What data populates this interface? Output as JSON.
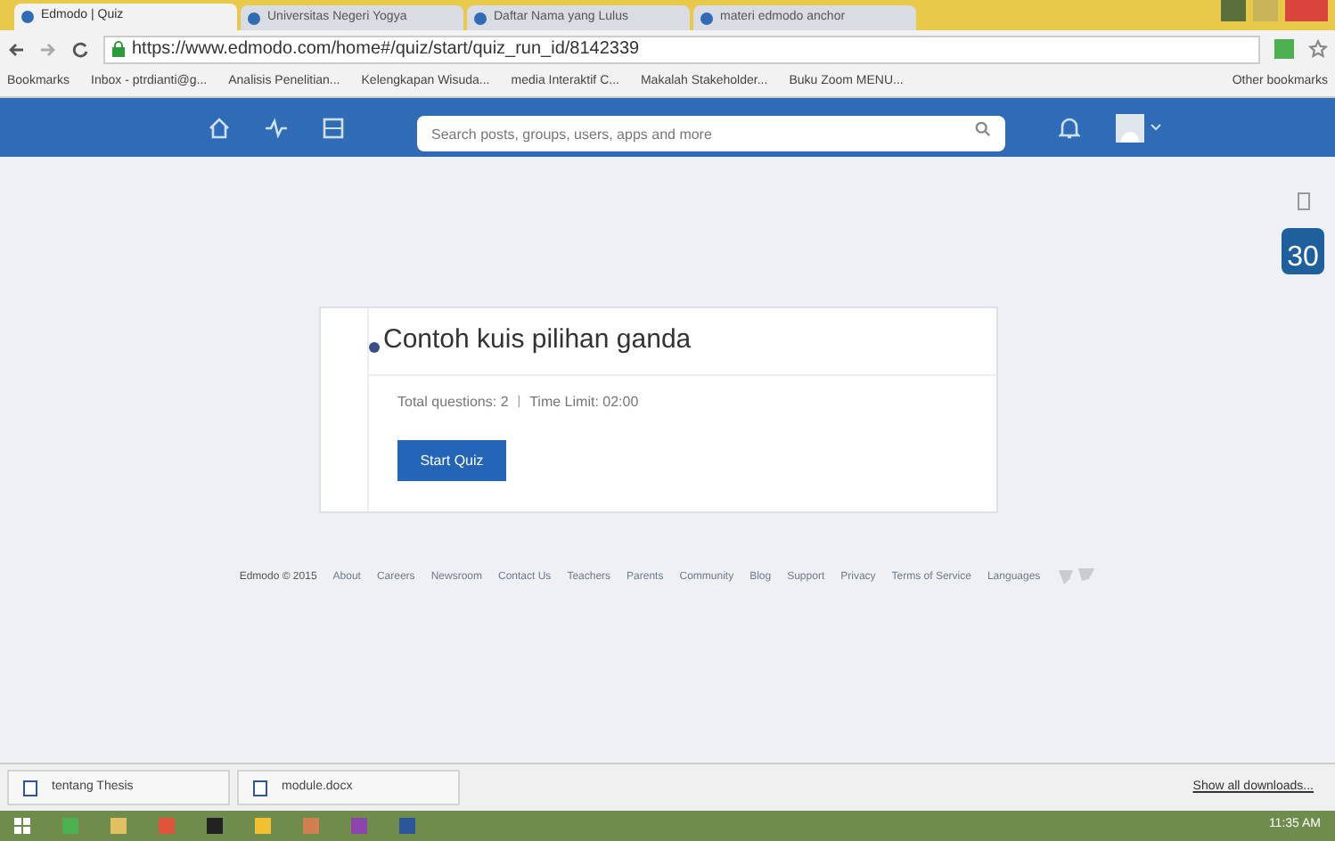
{
  "browser_tabs": [
    {
      "title": "Edmodo | Quiz",
      "selected": true
    },
    {
      "title": "Universitas Negeri Yogya",
      "selected": false
    },
    {
      "title": "Daftar Nama yang Lulus",
      "selected": false
    },
    {
      "title": "materi edmodo anchor",
      "selected": false
    }
  ],
  "address_bar": {
    "url": "https://www.edmodo.com/home#/quiz/start/quiz_run_id/8142339"
  },
  "bookmarks": [
    "Bookmarks",
    "Inbox - ptrdianti@g...",
    "Analisis Penelitian...",
    "Kelengkapan Wisuda...",
    "media Interaktif C...",
    "Makalah Stakeholder...",
    "Buku Zoom MENU..."
  ],
  "other_bookmarks": "Other bookmarks",
  "nav": {
    "search_placeholder": "Search posts, groups, users, apps and more"
  },
  "calendar_badge": "30",
  "quiz": {
    "title": "Contoh kuis pilihan ganda",
    "total_questions": "Total questions: 2",
    "separator": "|",
    "time_limit": "Time Limit: 02:00",
    "start_button": "Start Quiz"
  },
  "footer": {
    "copyright": "Edmodo © 2015",
    "links": [
      "About",
      "Careers",
      "Newsroom",
      "Contact Us",
      "Teachers",
      "Parents",
      "Community",
      "Blog",
      "Support",
      "Privacy",
      "Terms of Service",
      "Languages"
    ]
  },
  "downloads": {
    "items": [
      "tentang Thesis",
      "module.docx"
    ],
    "show_all": "Show all downloads..."
  },
  "taskbar": {
    "clock": "11:35 AM"
  }
}
